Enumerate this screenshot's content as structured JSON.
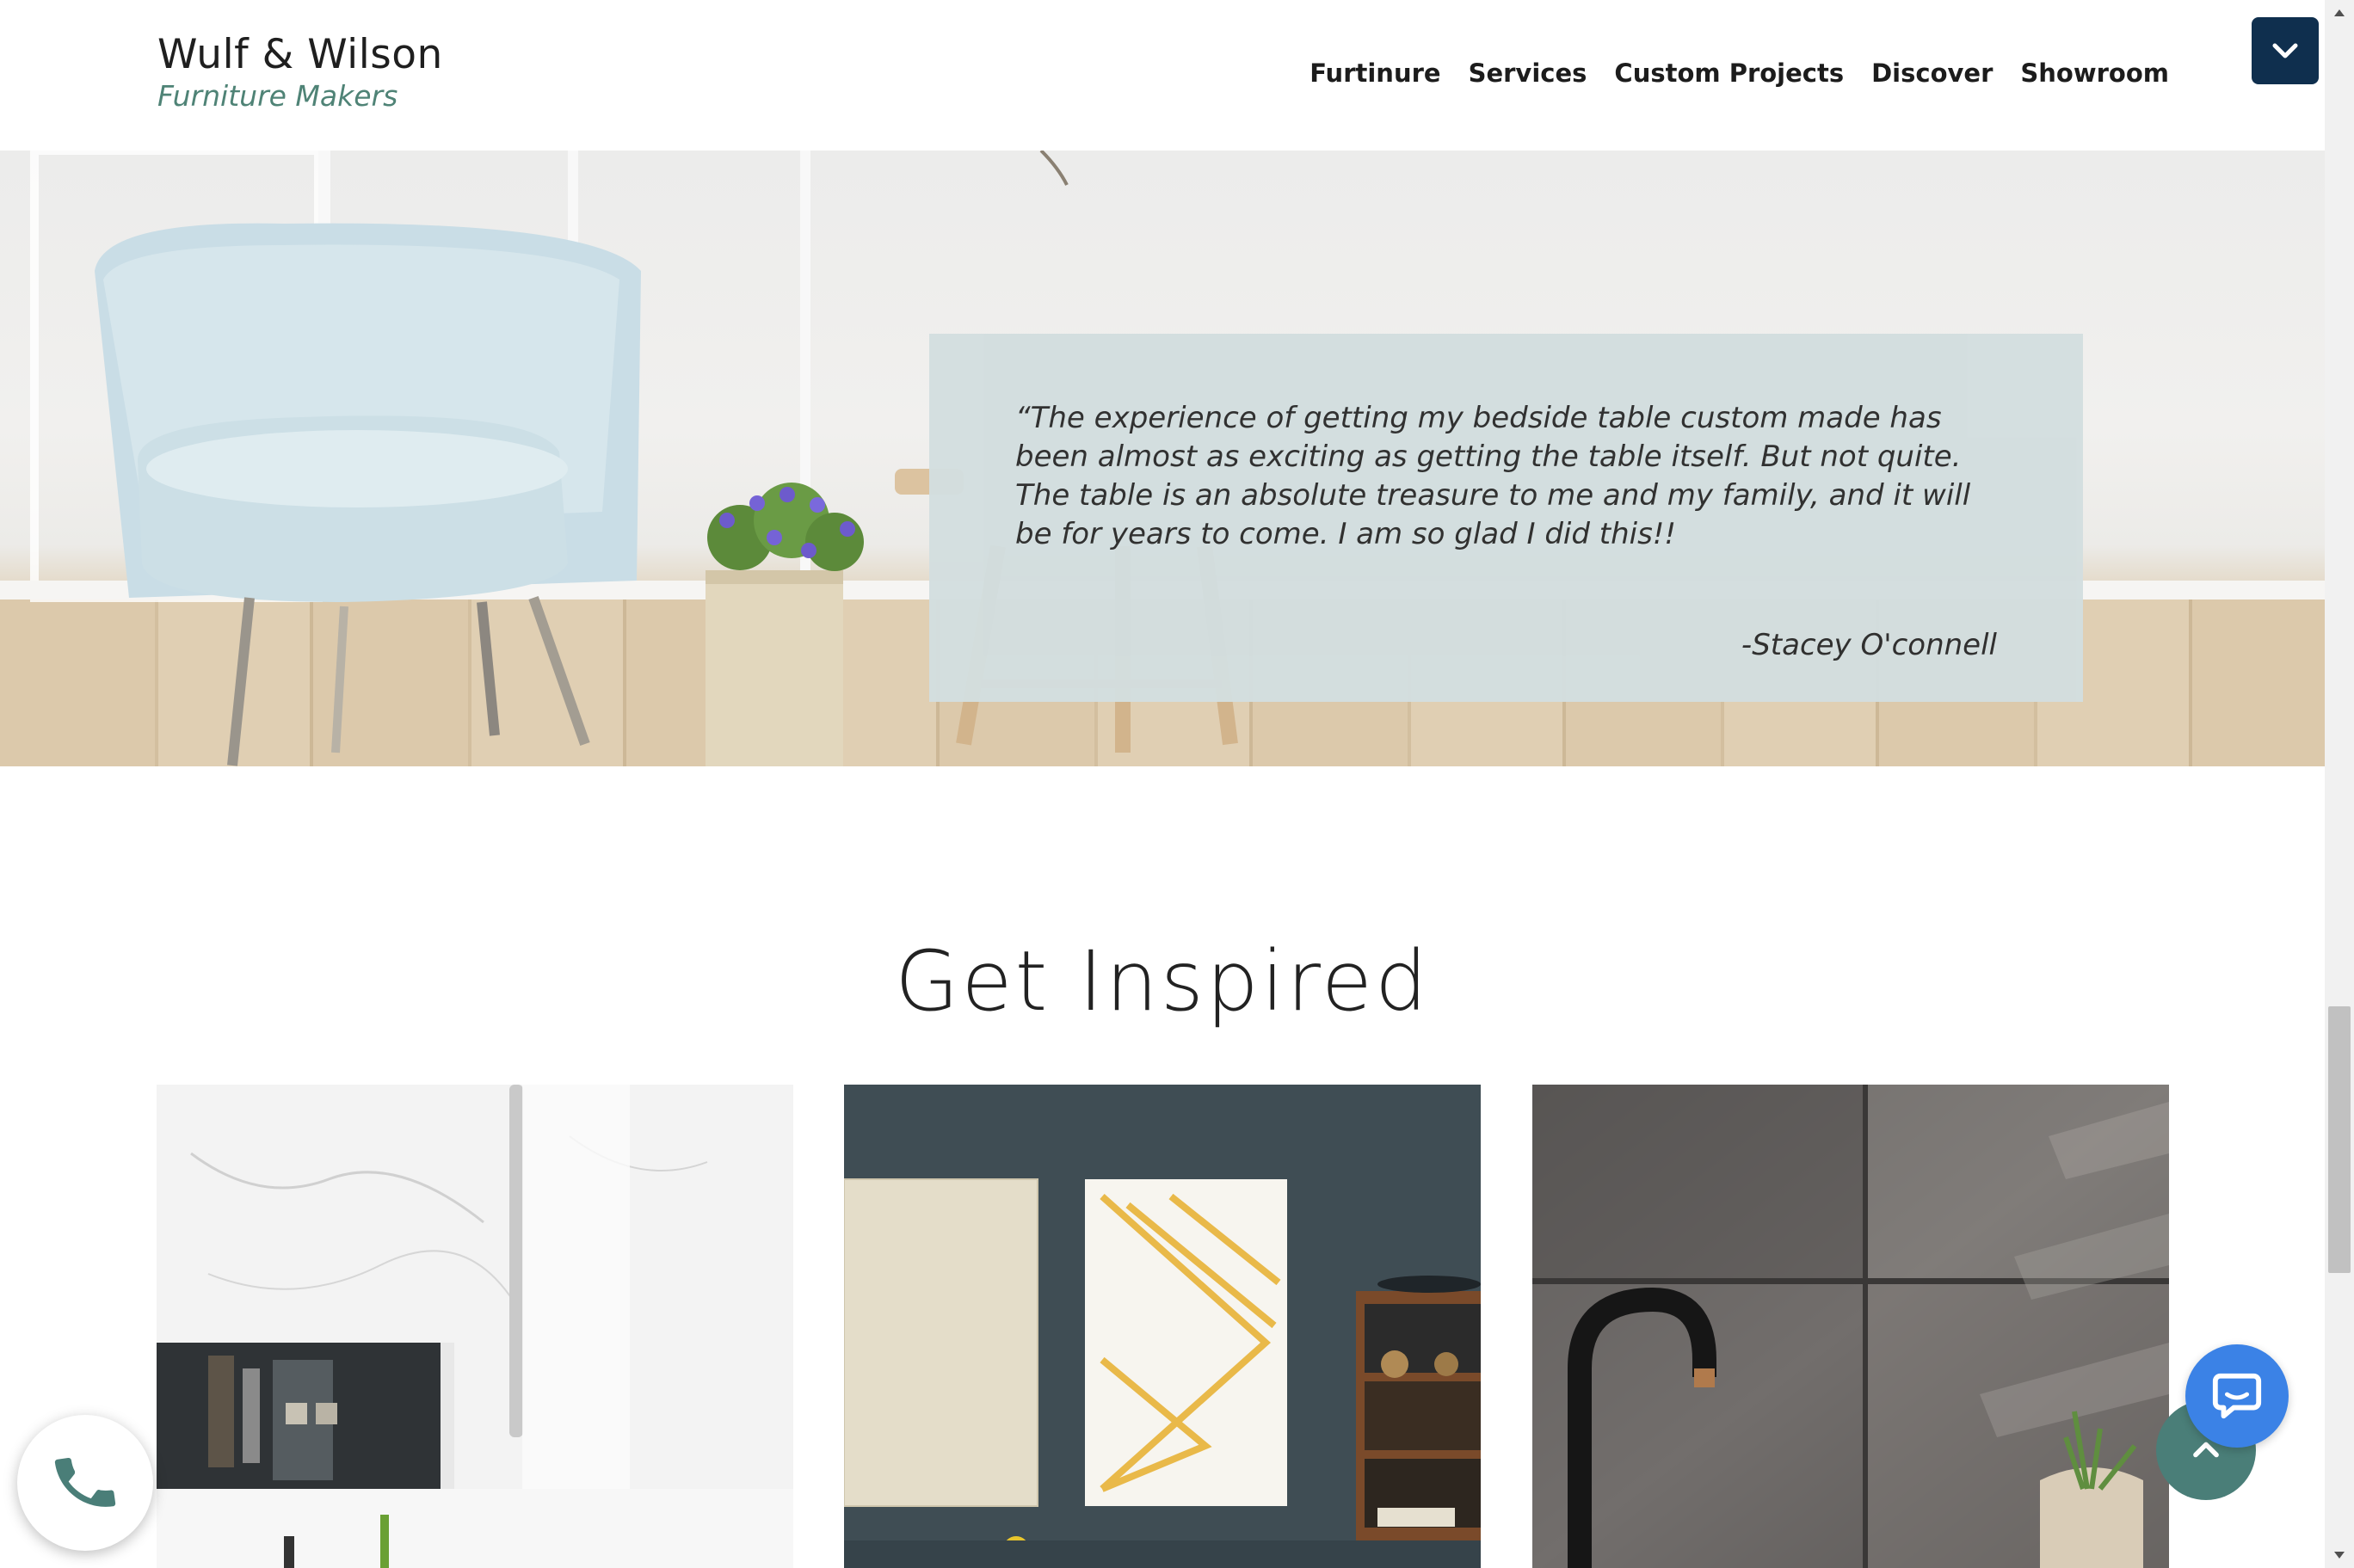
{
  "brand": {
    "name": "Wulf & Wilson",
    "tagline": "Furniture Makers"
  },
  "nav": {
    "items": [
      {
        "label": "Furtinure"
      },
      {
        "label": "Services"
      },
      {
        "label": "Custom Projects"
      },
      {
        "label": "Discover"
      },
      {
        "label": "Showroom"
      }
    ]
  },
  "testimonial": {
    "quote": "“The experience of getting my bedside table custom made has been almost as exciting as getting the table itself. But not quite.  The table is an absolute treasure to me and my family, and it will be for years to come.  I am so glad I did this!!",
    "author": "-Stacey O'connell"
  },
  "inspired": {
    "title": "Get Inspired"
  },
  "colors": {
    "header_bg": "#ffffff",
    "tagline": "#4f8376",
    "menu_toggle": "#0f2f4e",
    "quote_card": "#d3dedf",
    "chat_button": "#3b82e6",
    "back_to_top": "#4a7e78"
  },
  "icons": {
    "menu_toggle": "chevron-down-icon",
    "phone": "phone-icon",
    "back_to_top": "chevron-up-icon",
    "chat": "chat-icon"
  }
}
